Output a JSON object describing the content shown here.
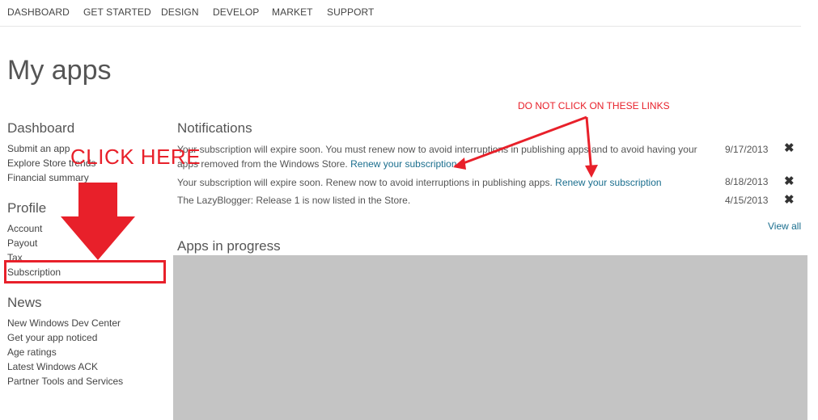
{
  "nav": {
    "items": [
      {
        "label": "DASHBOARD"
      },
      {
        "label": "GET STARTED"
      },
      {
        "label": "DESIGN"
      },
      {
        "label": "DEVELOP"
      },
      {
        "label": "MARKET"
      },
      {
        "label": "SUPPORT"
      }
    ]
  },
  "page": {
    "title": "My apps"
  },
  "sidebar": {
    "dashboard": {
      "heading": "Dashboard",
      "links": [
        "Submit an app",
        "Explore Store trends",
        "Financial summary"
      ]
    },
    "profile": {
      "heading": "Profile",
      "links": [
        "Account",
        "Payout",
        "Tax",
        "Subscription"
      ]
    },
    "news": {
      "heading": "News",
      "links": [
        "New Windows Dev Center",
        "Get your app noticed",
        "Age ratings",
        "Latest Windows ACK",
        "Partner Tools and Services"
      ]
    }
  },
  "notifications": {
    "heading": "Notifications",
    "items": [
      {
        "text": "Your subscription will expire soon. You must renew now to avoid interruptions in publishing apps and to avoid having your apps removed from the Windows Store.",
        "link": "Renew your subscription",
        "date": "9/17/2013"
      },
      {
        "text": "Your subscription will expire soon. Renew now to avoid interruptions in publishing apps.",
        "link": "Renew your subscription",
        "date": "8/18/2013"
      },
      {
        "text": "The LazyBlogger: Release 1 is now listed in the Store.",
        "link": "",
        "date": "4/15/2013"
      }
    ],
    "close_glyph": "✖",
    "view_all": "View all"
  },
  "apps_in_progress": {
    "heading": "Apps in progress"
  },
  "annotations": {
    "click_here": "CLICK HERE",
    "do_not_click": "DO NOT CLICK ON THESE LINKS",
    "color": "#e8202a"
  }
}
